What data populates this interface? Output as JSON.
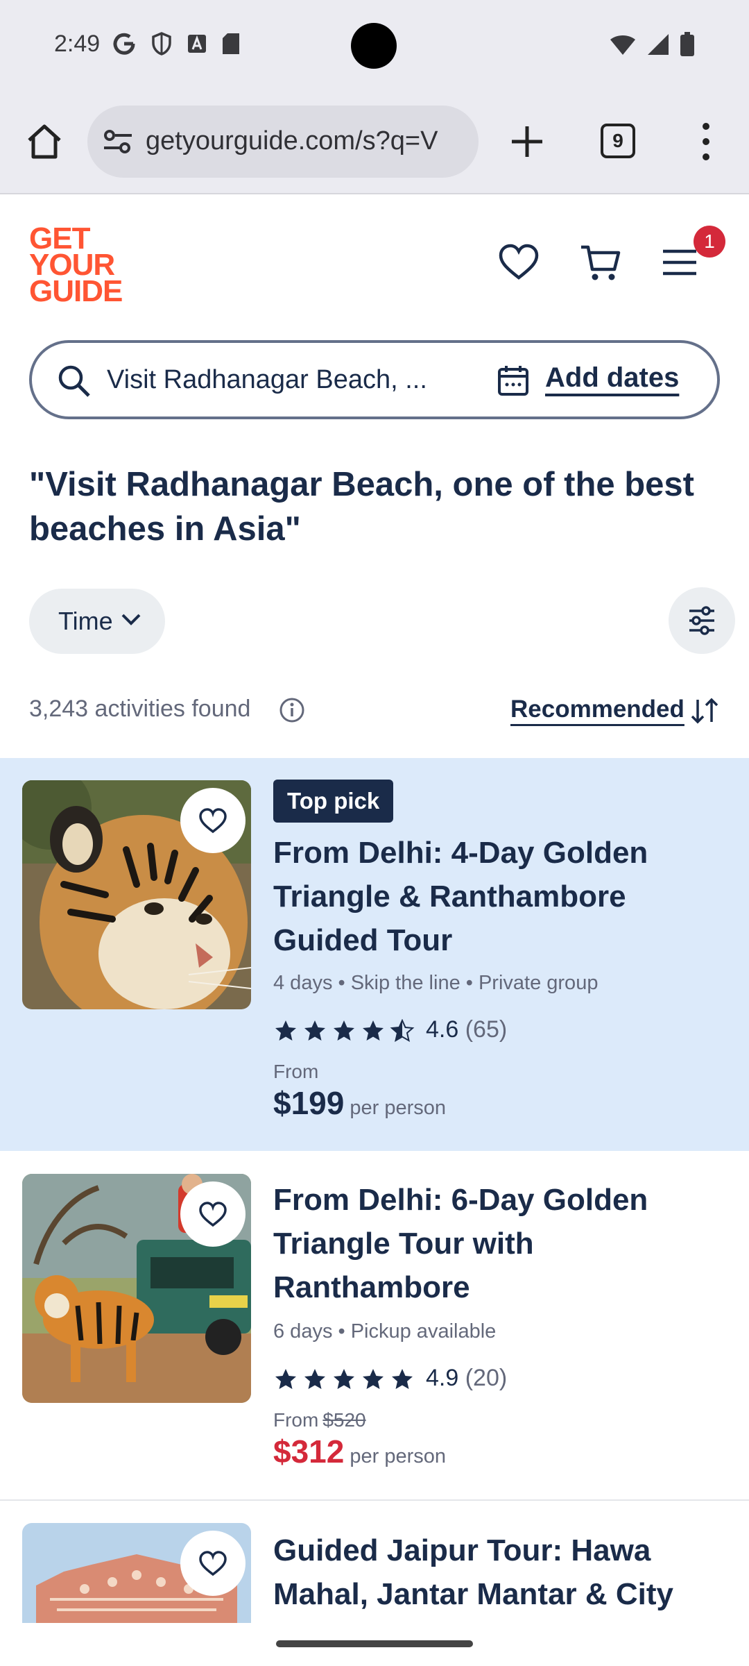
{
  "status": {
    "time": "2:49"
  },
  "browser": {
    "url": "getyourguide.com/s?q=V",
    "tab_count": "9"
  },
  "header": {
    "logo_lines": [
      "GET",
      "YOUR",
      "GUIDE"
    ],
    "cart_badge": "1"
  },
  "search": {
    "query": "Visit Radhanagar Beach, ...",
    "dates_label": "Add dates"
  },
  "page_title": "\"Visit Radhanagar Beach, one of the best beaches in Asia\"",
  "filters": {
    "time_label": "Time"
  },
  "results": {
    "count_text": "3,243 activities found",
    "sort_label": "Recommended"
  },
  "cards": [
    {
      "badge": "Top pick",
      "title": "From Delhi: 4-Day Golden Triangle & Ranthambore Guided Tour",
      "meta": "4 days • Skip the line • Private group",
      "rating": "4.6",
      "rating_value": 4.6,
      "reviews": "(65)",
      "from_label": "From",
      "old_price": "",
      "price": "$199",
      "per_person": "per person"
    },
    {
      "badge": "",
      "title": "From Delhi: 6-Day Golden Triangle Tour with Ranthambore",
      "meta": "6 days • Pickup available",
      "rating": "4.9",
      "rating_value": 4.9,
      "reviews": "(20)",
      "from_label": "From",
      "old_price": "$520",
      "price": "$312",
      "per_person": "per person"
    },
    {
      "title": "Guided Jaipur Tour: Hawa Mahal, Jantar Mantar & City"
    }
  ],
  "colors": {
    "brand": "#ff5533",
    "navy": "#1a2b49",
    "highlight": "#dceafa",
    "sale": "#d4293a"
  }
}
